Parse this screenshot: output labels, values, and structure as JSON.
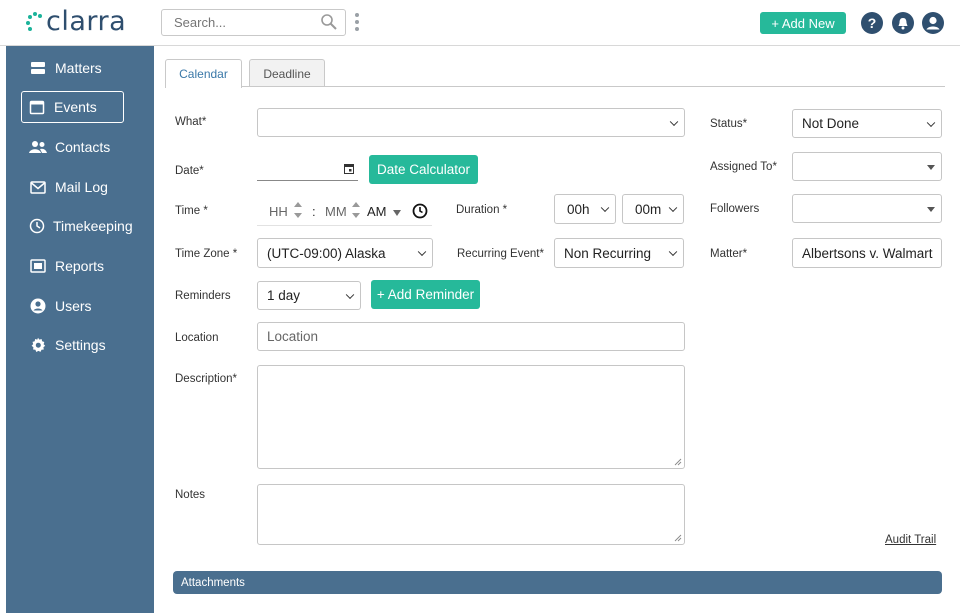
{
  "app": {
    "brand": "clarra",
    "search_placeholder": "Search...",
    "add_new_label": "+ Add New",
    "help_glyph": "?",
    "brand_color": "#26b99a",
    "navy_color": "#2f4f6f",
    "sidebar_color": "#4a6f8f"
  },
  "sidebar": {
    "items": [
      {
        "label": "Matters",
        "icon": "layers-icon"
      },
      {
        "label": "Events",
        "icon": "calendar-icon",
        "active": true
      },
      {
        "label": "Contacts",
        "icon": "people-icon"
      },
      {
        "label": "Mail Log",
        "icon": "mail-icon"
      },
      {
        "label": "Timekeeping",
        "icon": "clock-icon"
      },
      {
        "label": "Reports",
        "icon": "report-icon"
      },
      {
        "label": "Users",
        "icon": "user-icon"
      },
      {
        "label": "Settings",
        "icon": "gear-icon"
      }
    ]
  },
  "tabs": [
    {
      "label": "Calendar",
      "active": true
    },
    {
      "label": "Deadline",
      "active": false
    }
  ],
  "form": {
    "what": {
      "label": "What*",
      "value": ""
    },
    "status": {
      "label": "Status*",
      "value": "Not Done"
    },
    "date": {
      "label": "Date*",
      "value": ""
    },
    "date_calculator_label": "Date Calculator",
    "assigned_to": {
      "label": "Assigned To*",
      "value": ""
    },
    "time": {
      "label": "Time *",
      "hh_placeholder": "HH",
      "separator": ":",
      "mm_placeholder": "MM",
      "ampm": "AM"
    },
    "duration": {
      "label": "Duration *",
      "hours": "00h",
      "minutes": "00m"
    },
    "followers": {
      "label": "Followers",
      "value": ""
    },
    "time_zone": {
      "label": "Time Zone *",
      "value": "(UTC-09:00) Alaska"
    },
    "recurring": {
      "label": "Recurring Event*",
      "value": "Non Recurring"
    },
    "matter": {
      "label": "Matter*",
      "value": "Albertsons v. Walmart"
    },
    "reminders": {
      "label": "Reminders",
      "value": "1 day"
    },
    "add_reminder_label": "+ Add Reminder",
    "location": {
      "label": "Location",
      "placeholder": "Location"
    },
    "description": {
      "label": "Description*"
    },
    "notes": {
      "label": "Notes"
    },
    "audit_trail_label": "Audit Trail"
  },
  "attachments_label": "Attachments"
}
